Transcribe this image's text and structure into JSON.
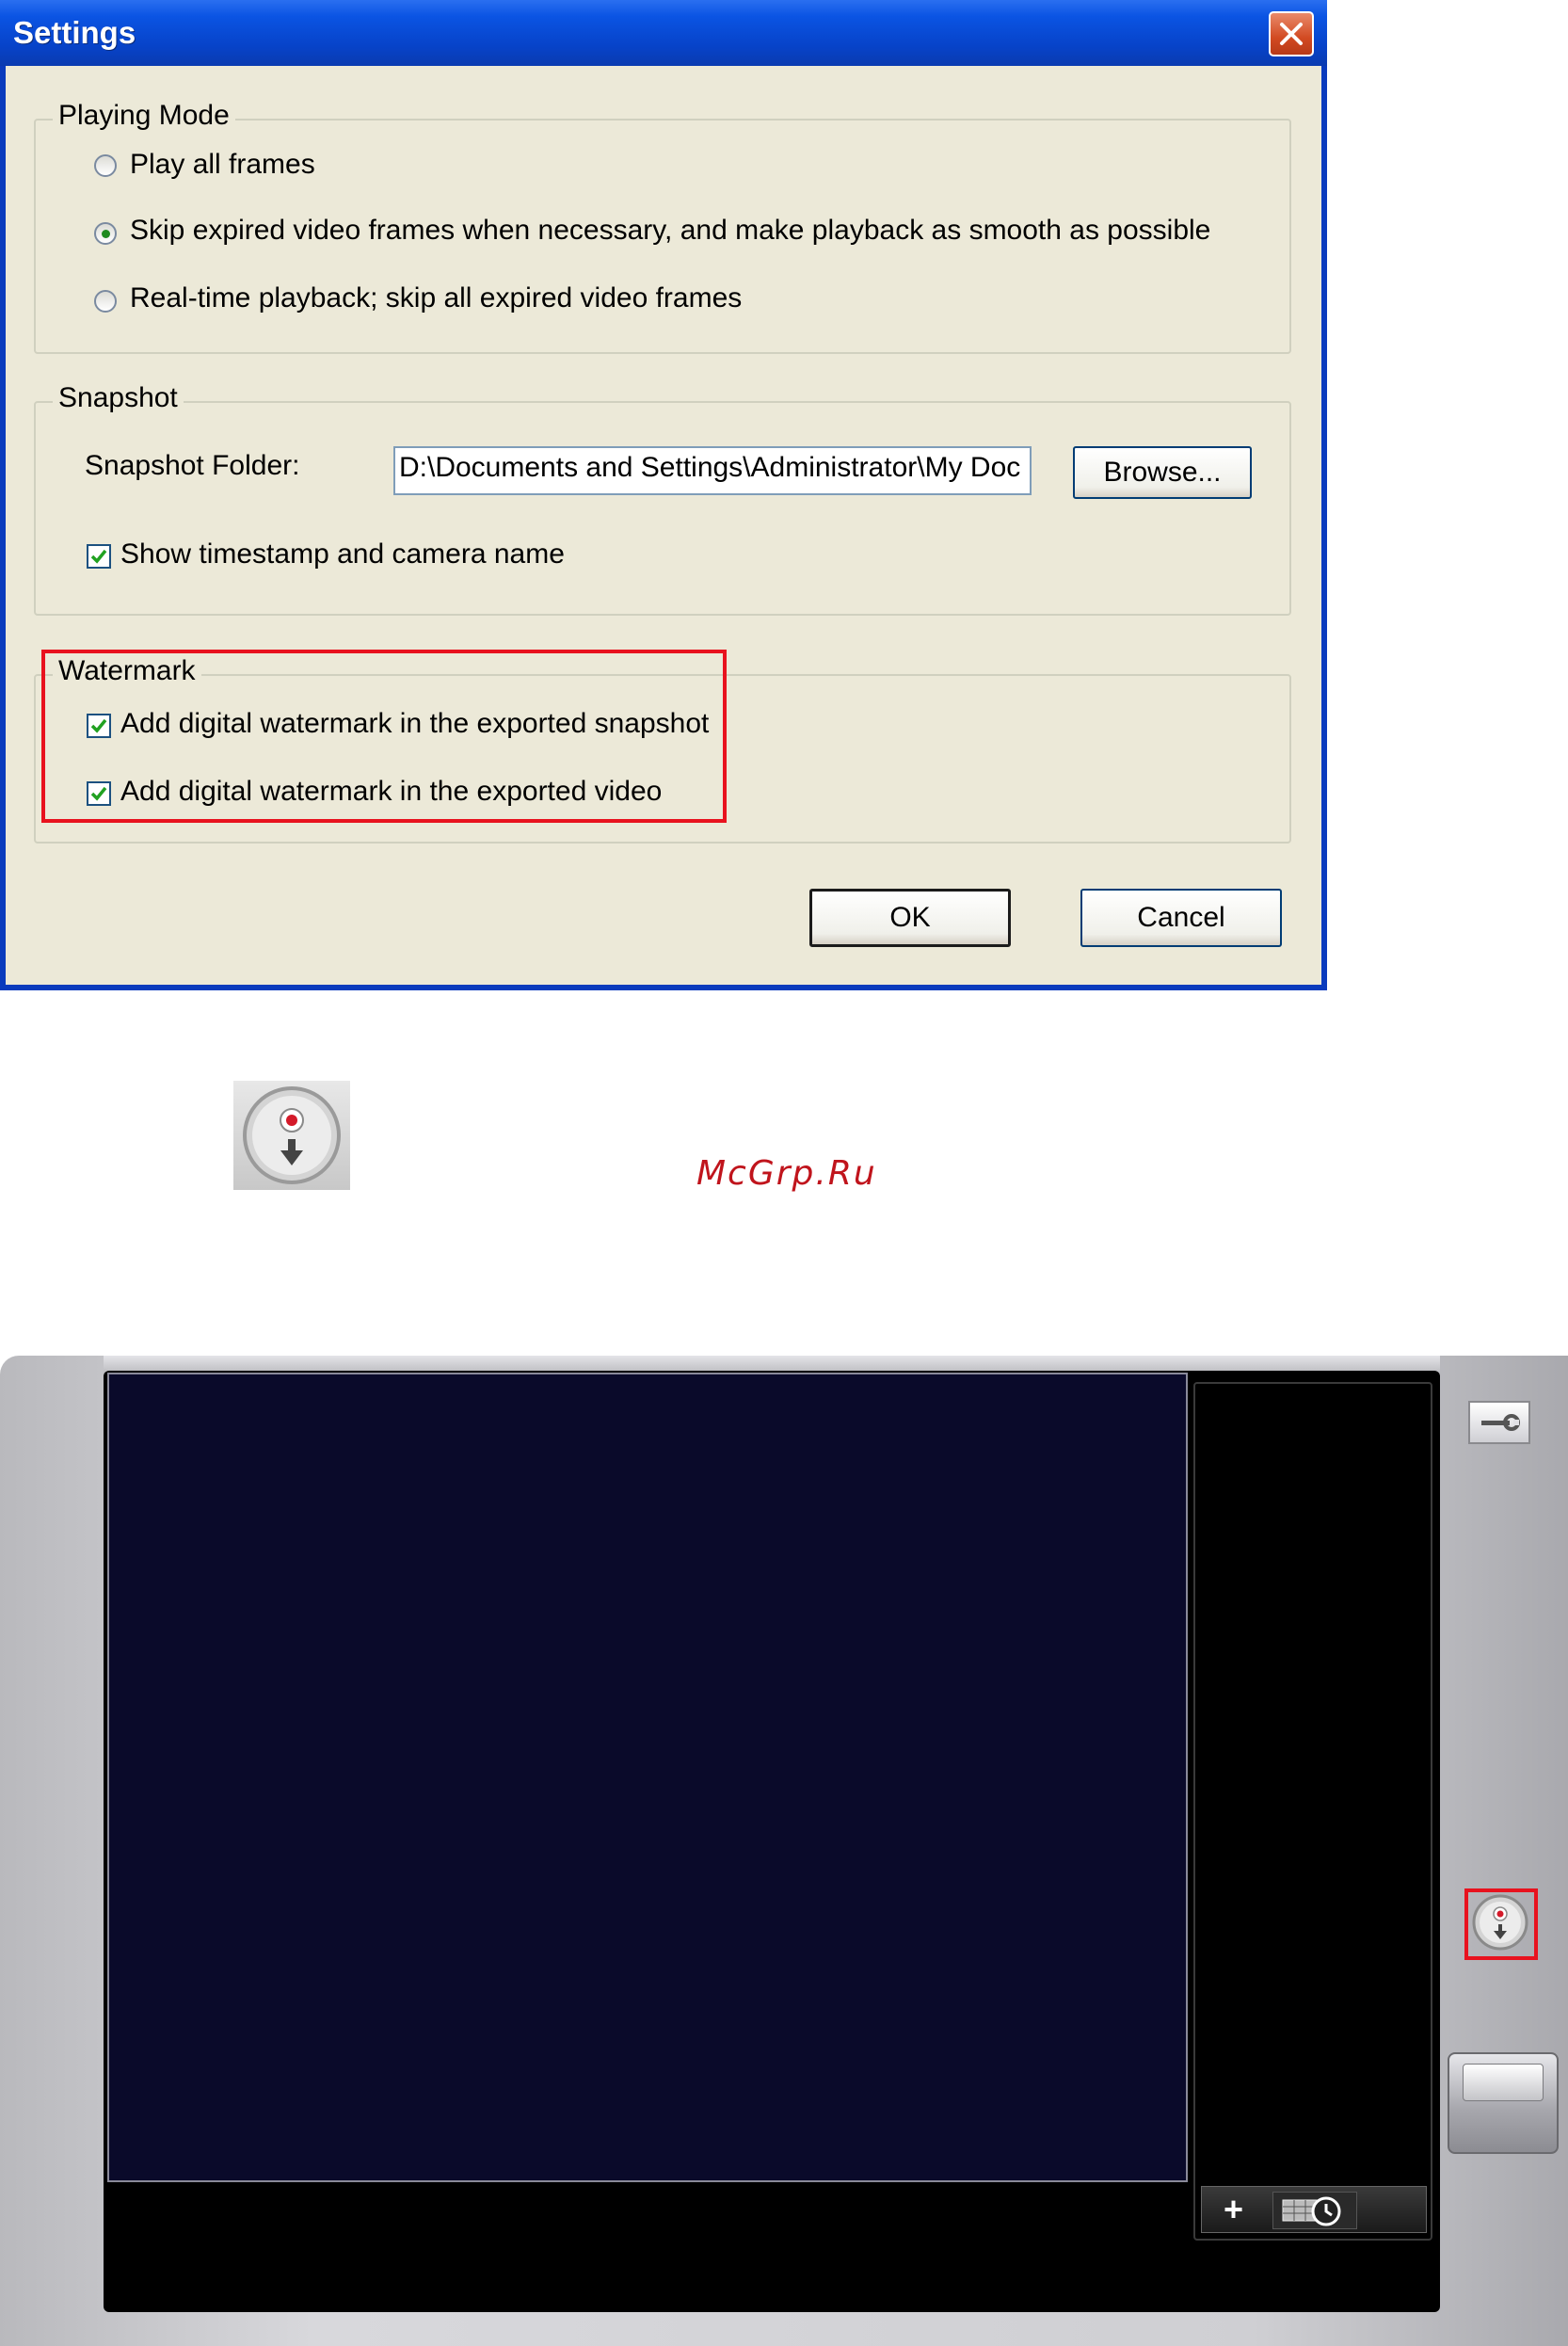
{
  "dialog": {
    "title": "Settings",
    "close_icon": "close-x-icon",
    "playing_mode": {
      "legend": "Playing Mode",
      "options": [
        {
          "label": "Play all frames",
          "selected": false
        },
        {
          "label": "Skip expired video frames when necessary, and make playback as smooth as possible",
          "selected": true
        },
        {
          "label": "Real-time playback; skip all expired video frames",
          "selected": false
        }
      ]
    },
    "snapshot": {
      "legend": "Snapshot",
      "folder_label": "Snapshot Folder:",
      "folder_value": "D:\\Documents and Settings\\Administrator\\My Doc",
      "browse_label": "Browse...",
      "timestamp_label": "Show timestamp and camera name",
      "timestamp_checked": true
    },
    "watermark": {
      "legend": "Watermark",
      "snapshot_label": "Add digital watermark in the exported snapshot",
      "snapshot_checked": true,
      "video_label": "Add digital watermark in the exported video",
      "video_checked": true
    },
    "ok_label": "OK",
    "cancel_label": "Cancel",
    "highlight_color": "#e8121e"
  },
  "middle": {
    "icon": "export-record-icon",
    "watermark_text": "McGrp.Ru"
  },
  "player": {
    "video_bg": "#0a0a2a",
    "settings_icon": "wrench-icon",
    "export_icon": "export-record-icon",
    "add_icon": "plus-icon",
    "schedule_icon": "calendar-clock-icon",
    "plus_text": "+"
  }
}
